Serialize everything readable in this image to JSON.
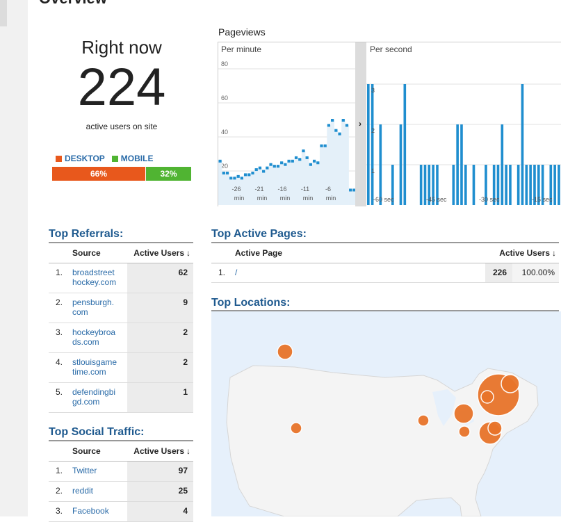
{
  "page": {
    "title": "Overview"
  },
  "right_now": {
    "label": "Right now",
    "count": "224",
    "sub": "active users on site",
    "legend": [
      {
        "label": "DESKTOP",
        "color": "#e8581c"
      },
      {
        "label": "MOBILE",
        "color": "#50b432"
      }
    ],
    "split": [
      {
        "label": "66%",
        "value": 0.66,
        "color": "#e8581c"
      },
      {
        "label": "32%",
        "value": 0.32,
        "color": "#50b432"
      }
    ]
  },
  "pageviews": {
    "title": "Pageviews",
    "per_minute": {
      "label": "Per minute",
      "y_ticks": [
        "80",
        "60",
        "40",
        "20"
      ],
      "x_ticks": [
        {
          "value": "-26",
          "unit": "min"
        },
        {
          "value": "-21",
          "unit": "min"
        },
        {
          "value": "-16",
          "unit": "min"
        },
        {
          "value": "-11",
          "unit": "min"
        },
        {
          "value": "-6",
          "unit": "min"
        }
      ],
      "ylim": [
        0,
        80
      ],
      "values": [
        26,
        19,
        19,
        16,
        16,
        17,
        16,
        18,
        18,
        19,
        21,
        22,
        20,
        22,
        24,
        23,
        23,
        25,
        24,
        26,
        26,
        28,
        27,
        32,
        28,
        24,
        26,
        25,
        35,
        35,
        47,
        50,
        44,
        42,
        50,
        47,
        9,
        9
      ]
    },
    "per_second": {
      "label": "Per second",
      "y_ticks": [
        "3",
        "2",
        "1"
      ],
      "x_ticks": [
        {
          "value": "-60",
          "unit": "sec"
        },
        {
          "value": "-45",
          "unit": "sec"
        },
        {
          "value": "-30",
          "unit": "sec"
        },
        {
          "value": "-15",
          "unit": "sec"
        }
      ],
      "ylim": [
        0,
        3
      ],
      "values": [
        3,
        3,
        0,
        2,
        0,
        0,
        1,
        0,
        2,
        3,
        0,
        0,
        0,
        1,
        1,
        1,
        1,
        1,
        0,
        0,
        0,
        1,
        2,
        2,
        1,
        0,
        1,
        0,
        0,
        1,
        0,
        1,
        1,
        2,
        1,
        1,
        0,
        1,
        3,
        1,
        1,
        1,
        1,
        1,
        0,
        1,
        1,
        1
      ]
    },
    "expand_glyph": "›"
  },
  "top_referrals": {
    "title": "Top Referrals:",
    "col_source": "Source",
    "col_users": "Active Users",
    "sort_glyph": "↓",
    "rows": [
      {
        "num": "1.",
        "source_l1": "broadstreet",
        "source_l2": "hockey.com",
        "users": "62"
      },
      {
        "num": "2.",
        "source_l1": "pensburgh.",
        "source_l2": "com",
        "users": "9"
      },
      {
        "num": "3.",
        "source_l1": "hockeybroa",
        "source_l2": "ds.com",
        "users": "2"
      },
      {
        "num": "4.",
        "source_l1": "stlouisgame",
        "source_l2": "time.com",
        "users": "2"
      },
      {
        "num": "5.",
        "source_l1": "defendingbi",
        "source_l2": "gd.com",
        "users": "1"
      }
    ]
  },
  "top_social": {
    "title": "Top Social Traffic:",
    "col_source": "Source",
    "col_users": "Active Users",
    "sort_glyph": "↓",
    "rows": [
      {
        "num": "1.",
        "source": "Twitter",
        "users": "97"
      },
      {
        "num": "2.",
        "source": "reddit",
        "users": "25"
      },
      {
        "num": "3.",
        "source": "Facebook",
        "users": "4"
      }
    ]
  },
  "top_pages": {
    "title": "Top Active Pages:",
    "col_page": "Active Page",
    "col_users": "Active Users",
    "sort_glyph": "↓",
    "rows": [
      {
        "num": "1.",
        "page": "/",
        "users": "226",
        "pct": "100.00%"
      }
    ]
  },
  "top_locations": {
    "title": "Top Locations:",
    "marker_color": "#e8742a",
    "land_color": "#f4f4f4",
    "water_color": "#e6f0fb"
  }
}
